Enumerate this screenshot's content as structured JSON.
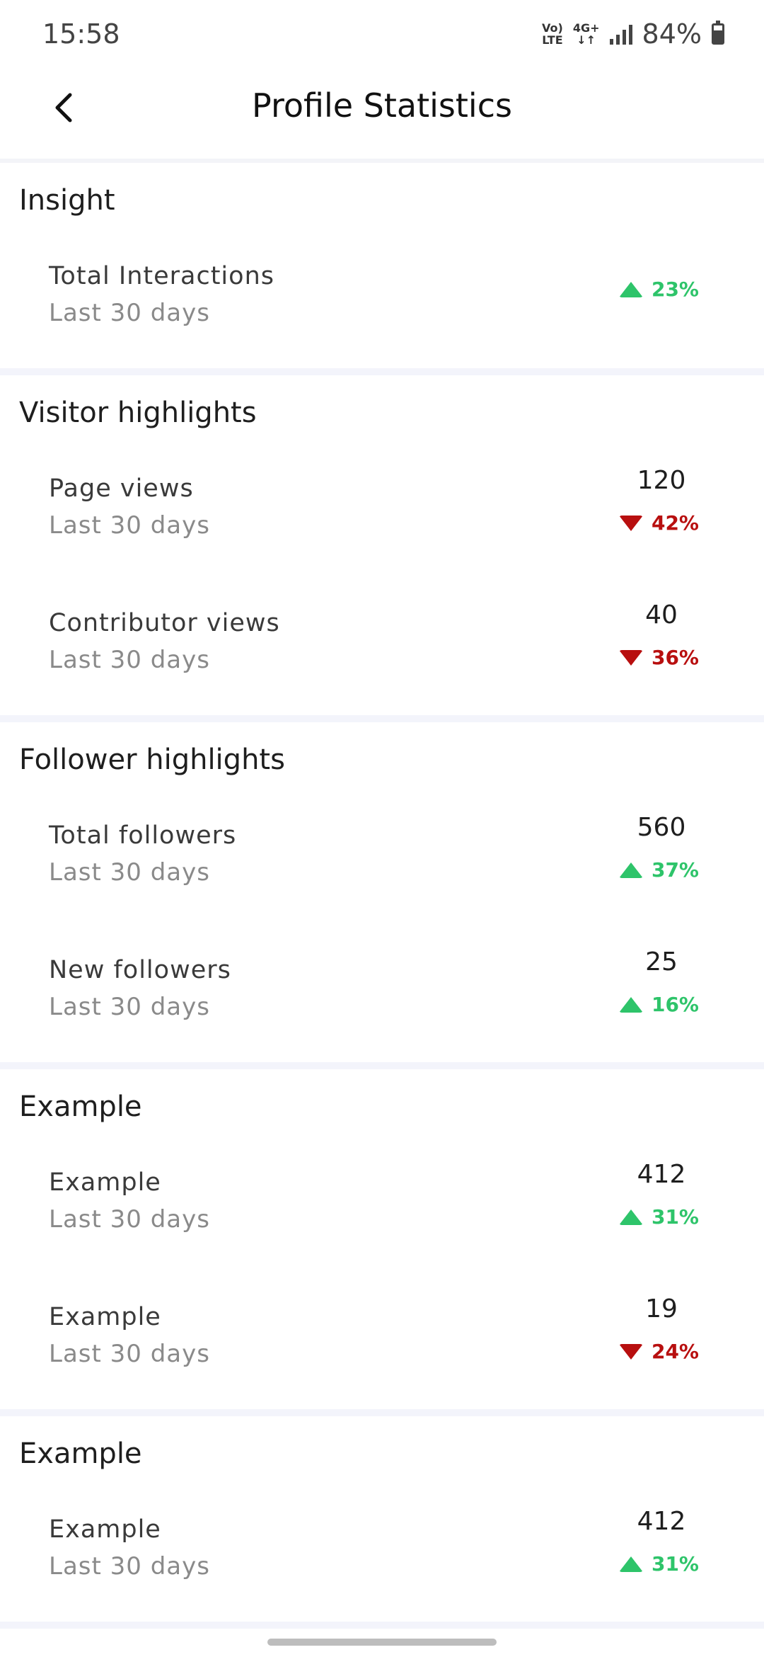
{
  "status_bar": {
    "time": "15:58",
    "network_1_top": "Vo)",
    "network_1_bottom": "LTE",
    "network_2_top": "4G+",
    "network_2_bottom": "↓↑",
    "battery": "84%"
  },
  "header": {
    "title": "Profile Statistics",
    "back_icon": "chevron-left-icon"
  },
  "colors": {
    "up": "#2ec46a",
    "down": "#b80f0f",
    "divider": "#f3f4fb"
  },
  "sections": [
    {
      "title": "Insight",
      "rows": [
        {
          "label": "Total Interactions",
          "sub": "Last 30 days",
          "value": "",
          "change": "23%",
          "direction": "up"
        }
      ]
    },
    {
      "title": "Visitor highlights",
      "rows": [
        {
          "label": "Page views",
          "sub": "Last 30 days",
          "value": "120",
          "change": "42%",
          "direction": "down"
        },
        {
          "label": "Contributor views",
          "sub": "Last 30 days",
          "value": "40",
          "change": "36%",
          "direction": "down"
        }
      ]
    },
    {
      "title": "Follower highlights",
      "rows": [
        {
          "label": "Total followers",
          "sub": "Last 30 days",
          "value": "560",
          "change": "37%",
          "direction": "up"
        },
        {
          "label": "New followers",
          "sub": "Last 30 days",
          "value": "25",
          "change": "16%",
          "direction": "up"
        }
      ]
    },
    {
      "title": "Example",
      "rows": [
        {
          "label": "Example",
          "sub": "Last 30 days",
          "value": "412",
          "change": "31%",
          "direction": "up"
        },
        {
          "label": "Example",
          "sub": "Last 30 days",
          "value": "19",
          "change": "24%",
          "direction": "down"
        }
      ]
    },
    {
      "title": "Example",
      "rows": [
        {
          "label": "Example",
          "sub": "Last 30 days",
          "value": "412",
          "change": "31%",
          "direction": "up"
        }
      ]
    }
  ]
}
